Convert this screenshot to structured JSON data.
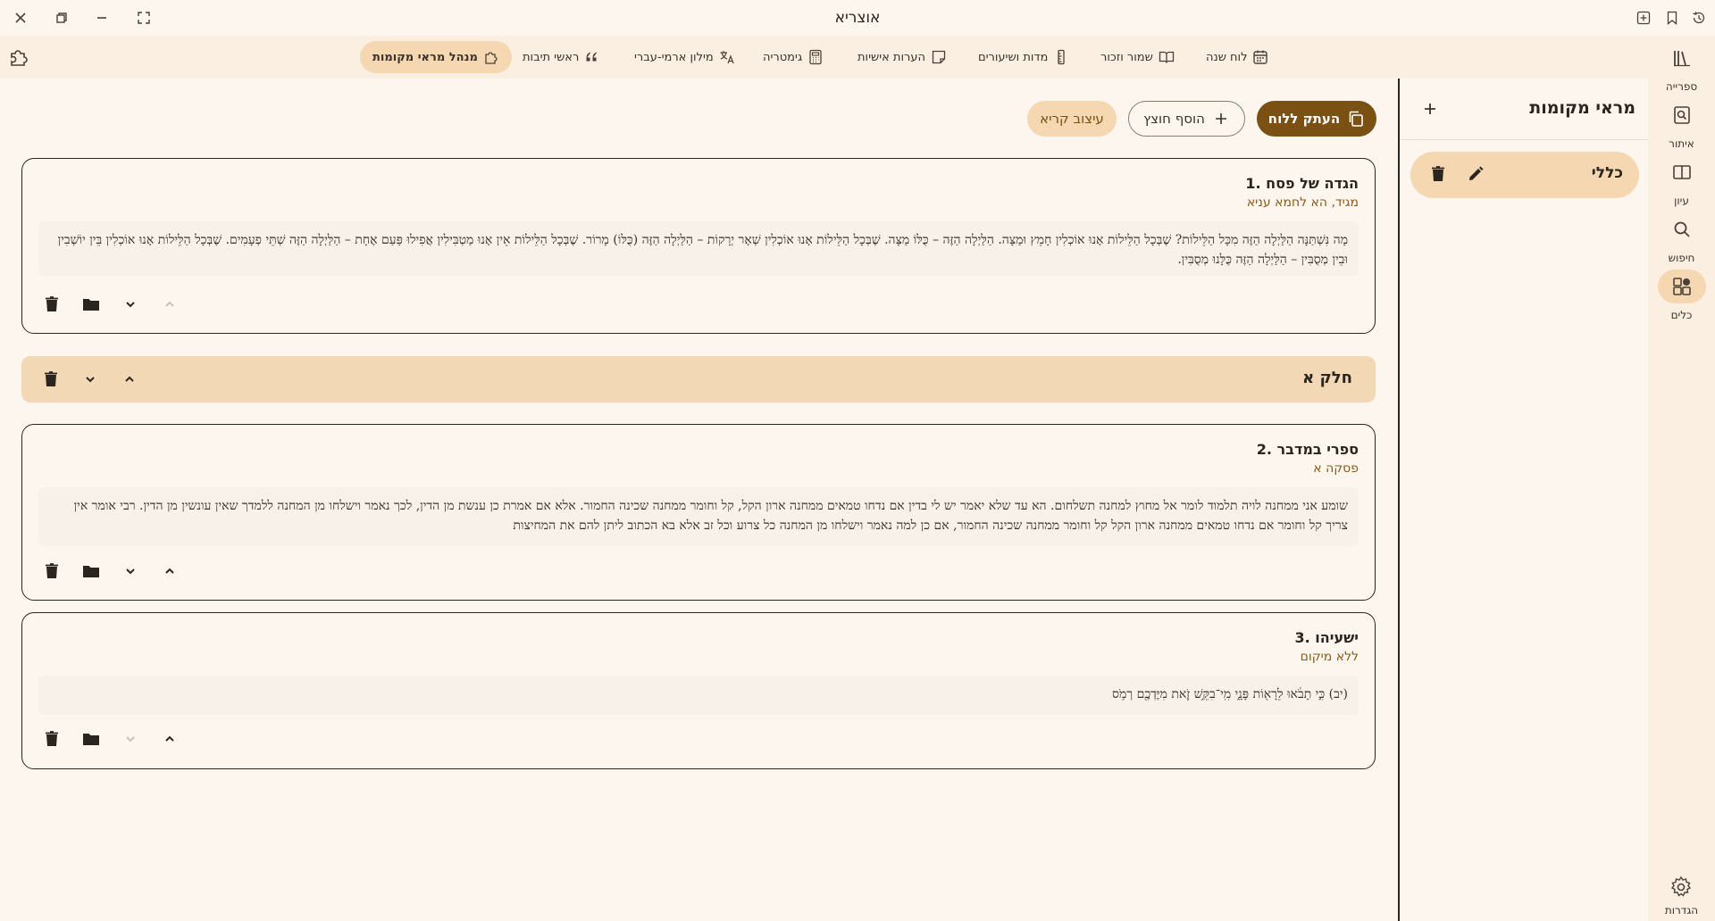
{
  "window": {
    "title": "אוצריא"
  },
  "toolbar": {
    "tabs": [
      {
        "label": "לוח שנה",
        "icon": "calendar-icon"
      },
      {
        "label": "שמור וזכור",
        "icon": "book-open-icon"
      },
      {
        "label": "מדות ושיעורים",
        "icon": "ruler-icon"
      },
      {
        "label": "הערות אישיות",
        "icon": "note-icon"
      },
      {
        "label": "גימטריה",
        "icon": "calculator-icon"
      },
      {
        "label": "מילון ארמי-עברי",
        "icon": "translate-icon"
      },
      {
        "label": "ראשי תיבות",
        "icon": "quote-icon"
      },
      {
        "label": "מנהל מראי מקומות",
        "icon": "puzzle-icon"
      }
    ],
    "active_index": 7
  },
  "rail": {
    "items": [
      {
        "label": "ספרייה",
        "icon": "library-icon"
      },
      {
        "label": "איתור",
        "icon": "locate-icon"
      },
      {
        "label": "עיון",
        "icon": "book-split-icon"
      },
      {
        "label": "חיפוש",
        "icon": "search-icon"
      },
      {
        "label": "כלים",
        "icon": "tools-icon"
      }
    ],
    "active_index": 4,
    "settings_label": "הגדרות"
  },
  "sidebar": {
    "title": "מראי מקומות",
    "group_label": "כללי"
  },
  "actions": {
    "copy_label": "העתק ללוח",
    "add_label": "הוסף חוצץ",
    "style_label": "עיצוב קריא"
  },
  "cards": [
    {
      "title": "1. הגדה של פסח",
      "subtitle": "מגיד, הא לחמא עניא",
      "text": "מָה נִּשְׁתַּנָּה הַלַּיְלָה הַזֶּה מִכָּל הַלֵּילוֹת? שֶׁבְּכָל הַלֵּילוֹת אָנוּ אוֹכְלִין חָמֵץ וּמַצָּה. הַלַּיְלָה הַזֶּה – כֻּלּוֹ מַצָּה. שֶׁבְּכָל הַלֵּילוֹת אָנוּ אוֹכְלִין שְׁאָר יְרָקוֹת – הַלַּיְלָה הַזֶּה (כֻּלּוֹ) מָרוֹר. שֶׁבְּכָל הַלֵּילוֹת אֵין אָנוּ מַטְבִּילִין אֲפִילוּ פַּעַם אֶחָת – הַלַּיְלָה הַזֶּה שְׁתֵּי פְעָמִים. שֶׁבְּכָל הַלֵּילוֹת אָנוּ אוֹכְלִין בֵּין יוֹשְׁבִין וּבֵין מְסֻבִּין – הַלַּיְלָה הַזֶּה כֻּלָּנוּ מְסֻבִּין."
    },
    {
      "title": "2. ספרי במדבר",
      "subtitle": "פסקה א",
      "text": "שומע אני ממחנה לויה תלמוד לומר אל מחוץ למחנה תשלחום. הא עד שלא יאמר יש לי בדין אם נדחו טמאים ממחנה ארון הקל, קל וחומר ממחנה שכינה החמור. אלא אם אמרת כן ענשת מן הדין, לכך נאמר וישלחו מן המחנה ללמדך שאין עונשין מן הדין. רבי אומר אין צריך קל וחומר אם נדחו טמאים ממחנה ארון הקל קל וחומר ממחנה שכינה החמור, אם כן למה נאמר וישלחו מן המחנה כל צרוע וכל זב אלא בא הכתוב ליתן להם את המחיצות"
    },
    {
      "title": "3. ישעיהו",
      "subtitle": "ללא מיקום",
      "text": "(יב) כִּ֣י תָבֹ֔אוּ לֵרָא֖וֹת פָּנָ֑י מִֽי־בִקֵּ֥שׁ זֹ֛את מִיֶּדְכֶ֖ם רְמֹ֥ס"
    }
  ],
  "section": {
    "title": "חלק א"
  },
  "colors": {
    "background": "#fdf6ee",
    "accent": "#7a5013",
    "chip": "#f5d7b2",
    "subtitle": "#8a5a18"
  }
}
